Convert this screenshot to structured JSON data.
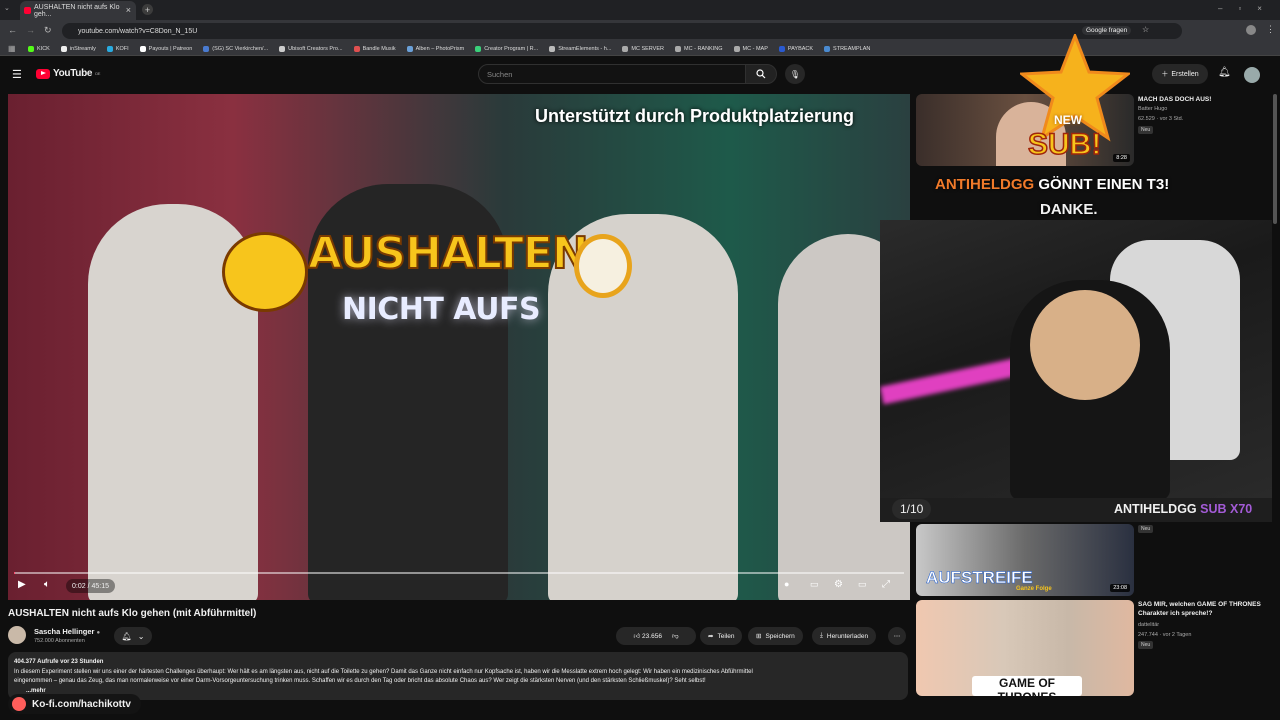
{
  "browser": {
    "tab_title": "AUSHALTEN nicht aufs Klo geh...",
    "url": "youtube.com/watch?v=C8Don_N_15U",
    "google_ask": "Google fragen",
    "bookmarks": [
      "KICK",
      "inStreamly",
      "KOFI",
      "Payouts | Patreon",
      "(SG) SC Vierkirchen/...",
      "Ubisoft Creators Pro...",
      "Bandle Musik",
      "Alben – PhotoPrism",
      "Creator Program | R...",
      "StreamElements - h...",
      "MC SERVER",
      "MC - RANKING",
      "MC - MAP",
      "PAYBACK",
      "STREAMPLAN"
    ],
    "bookmark_colors": [
      "#53fc18",
      "#eeeeee",
      "#29abe0",
      "#ffffff",
      "#4a7bd0",
      "#cccccc",
      "#e05050",
      "#6aa0d8",
      "#3ad07a",
      "#bbbbbb",
      "#aaaaaa",
      "#aaaaaa",
      "#aaaaaa",
      "#2a5ad0",
      "#4a8ad0"
    ]
  },
  "youtube": {
    "logo": "YouTube",
    "logo_region": "DE",
    "search_placeholder": "Suchen",
    "create_label": "Erstellen"
  },
  "video": {
    "sponsor_notice": "Unterstützt durch Produktplatzierung",
    "overlay_title": "AUSHALTEN",
    "overlay_subtitle": "NICHT AUFS",
    "time": "0:02 / 45:15",
    "progress_fraction": 0.0007
  },
  "details": {
    "title": "AUSHALTEN nicht aufs Klo gehen (mit Abführmittel)",
    "channel": "Sascha Hellinger",
    "subscribers": "752.000 Abonnenten",
    "likes": "23.656",
    "share": "Teilen",
    "save": "Speichern",
    "download": "Herunterladen",
    "views_date": "404.377 Aufrufe  vor 23 Stunden",
    "description_1": "In diesem Experiment stellen wir uns einer der härtesten Challenges überhaupt: Wer hält es am längsten aus, nicht auf die Toilette zu gehen? Damit das Ganze nicht einfach nur Kopfsache ist, haben wir die Messlatte extrem hoch gelegt: Wir haben ein medizinisches Abführmittel",
    "description_2": "eingenommen – genau das Zeug, das man normalerweise vor einer Darm-Vorsorgeuntersuchung trinken muss. Schaffen wir es durch den Tag oder bricht das absolute Chaos aus? Wer zeigt die stärksten Nerven (und den stärksten Schließmuskel)? Seht selbst!",
    "more": "...mehr"
  },
  "sidebar": [
    {
      "title": "MACH DAS DOCH AUS!",
      "channel": "Batter Hugo",
      "meta": "62.529 · vor 3 Std.",
      "badge": "Neu",
      "duration": "8:28"
    },
    {
      "title": "",
      "channel": "",
      "meta": "",
      "badge": "Neu",
      "duration": "23:08",
      "thumb_text": "AUFSTREIFE",
      "thumb_sub": "Ganze Folge"
    },
    {
      "title": "SAG MIR, welchen GAME OF THRONES Charakter ich spreche!?",
      "channel": "dattelitär",
      "meta": "247.744 · vor 2 Tagen",
      "badge": "Neu",
      "thumb_text": "GAME OF THRONES"
    }
  ],
  "stream_overlay": {
    "alert_new": "NEW",
    "alert_sub": "SUB!",
    "alert_user": "ANTIHELDGG",
    "alert_message": "GÖNNT EINEN T3!",
    "alert_thanks": "DANKE.",
    "counter": "1/10",
    "sub_goal_name": "ANTIHELDGG",
    "sub_goal_count": "SUB X70",
    "kofi": "Ko-fi.com/hachikottv",
    "accent_purple": "#a35bd6",
    "accent_orange": "#f07a2a"
  }
}
